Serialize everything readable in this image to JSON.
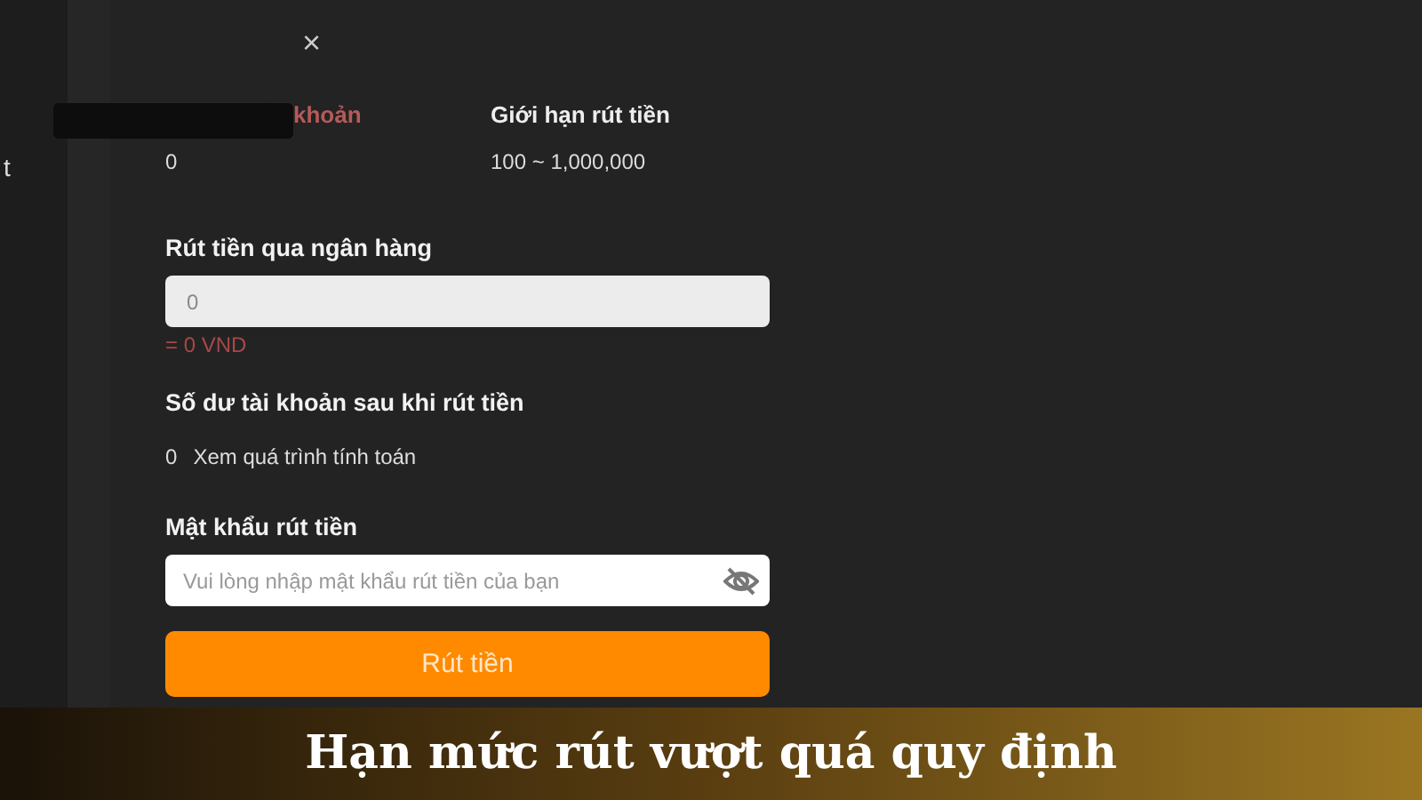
{
  "sidebar": {
    "items": [
      {
        "label": "t"
      }
    ]
  },
  "dialog": {
    "close": "×",
    "stats": [
      {
        "label": "khoản",
        "value": "0",
        "kind": "alert"
      },
      {
        "label": "Giới hạn rút tiền",
        "value": "100 ~ 1,000,000",
        "kind": "plain"
      }
    ],
    "amount": {
      "label": "Rút tiền qua ngân hàng",
      "placeholder": "0",
      "converted": "= 0 VND"
    },
    "balance_after": {
      "label": "Số dư tài khoản sau khi rút tiền",
      "value": "0",
      "link": "Xem quá trình tính toán"
    },
    "password": {
      "label": "Mật khẩu rút tiền",
      "placeholder": "Vui lòng nhập mật khẩu rút tiền của bạn"
    },
    "submit": "Rút tiền"
  },
  "caption": "Hạn mức rút vượt quá quy định"
}
